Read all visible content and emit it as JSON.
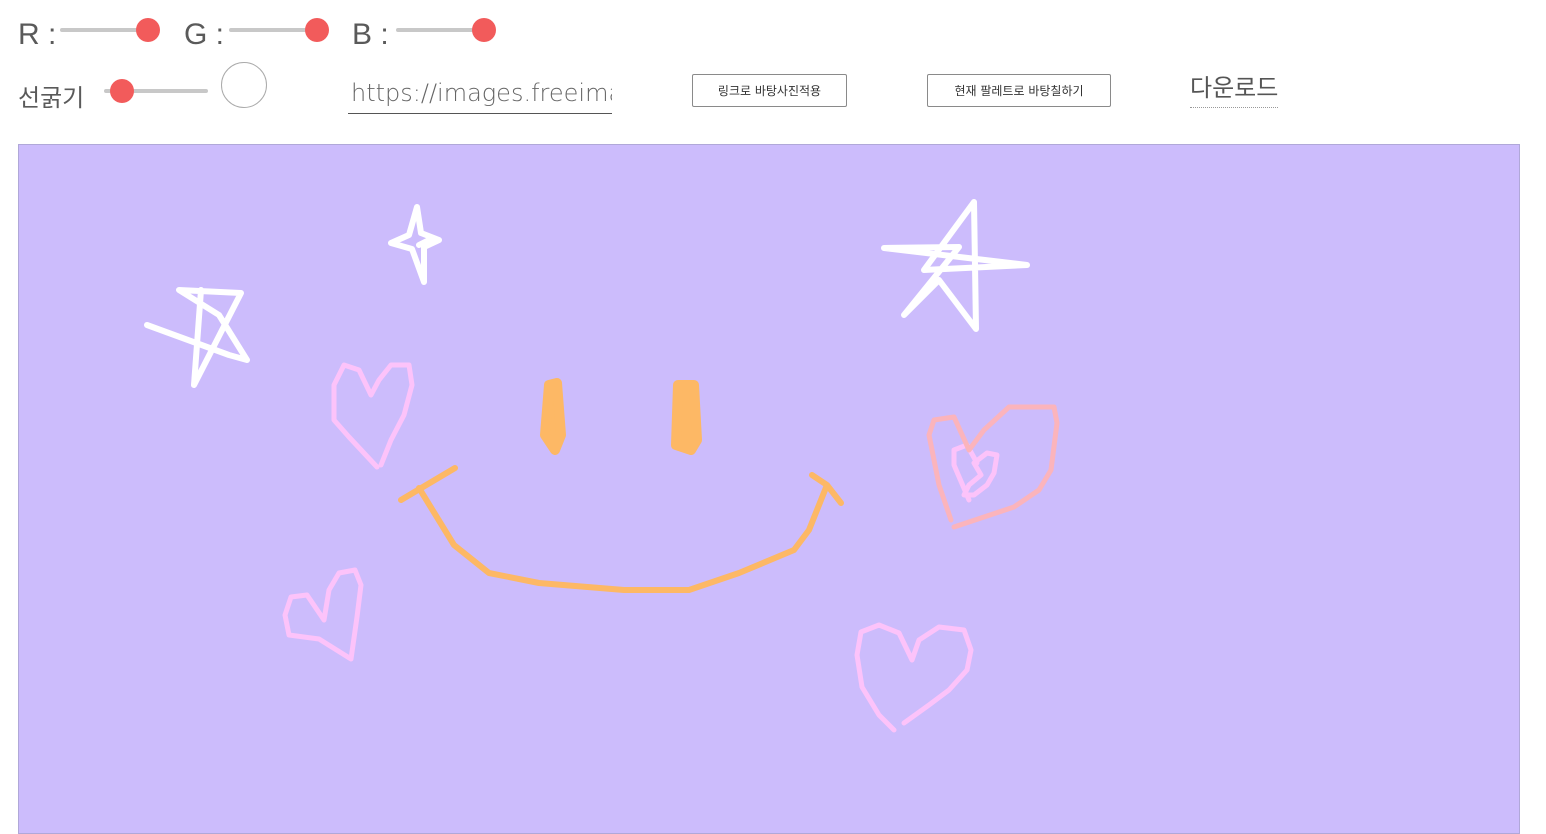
{
  "color_controls": {
    "r_label": "R :",
    "g_label": "G :",
    "b_label": "B :",
    "thumb_color": "#f25b5b",
    "track_color": "#c8c8c8"
  },
  "brush": {
    "label": "선굵기",
    "preview_color": "#ffffff"
  },
  "url_input": {
    "value": "https://images.freeimages"
  },
  "buttons": {
    "apply_bg_link": "링크로 바탕사진적용",
    "fill_with_palette": "현재 팔레트로 바탕칠하기",
    "download": "다운로드"
  },
  "canvas": {
    "background": "#ccbcfc",
    "stroke_colors": {
      "white": "#ffffff",
      "orange": "#fdb865",
      "pink": "#fcc3fa",
      "salmon": "#fbb4bc"
    }
  }
}
